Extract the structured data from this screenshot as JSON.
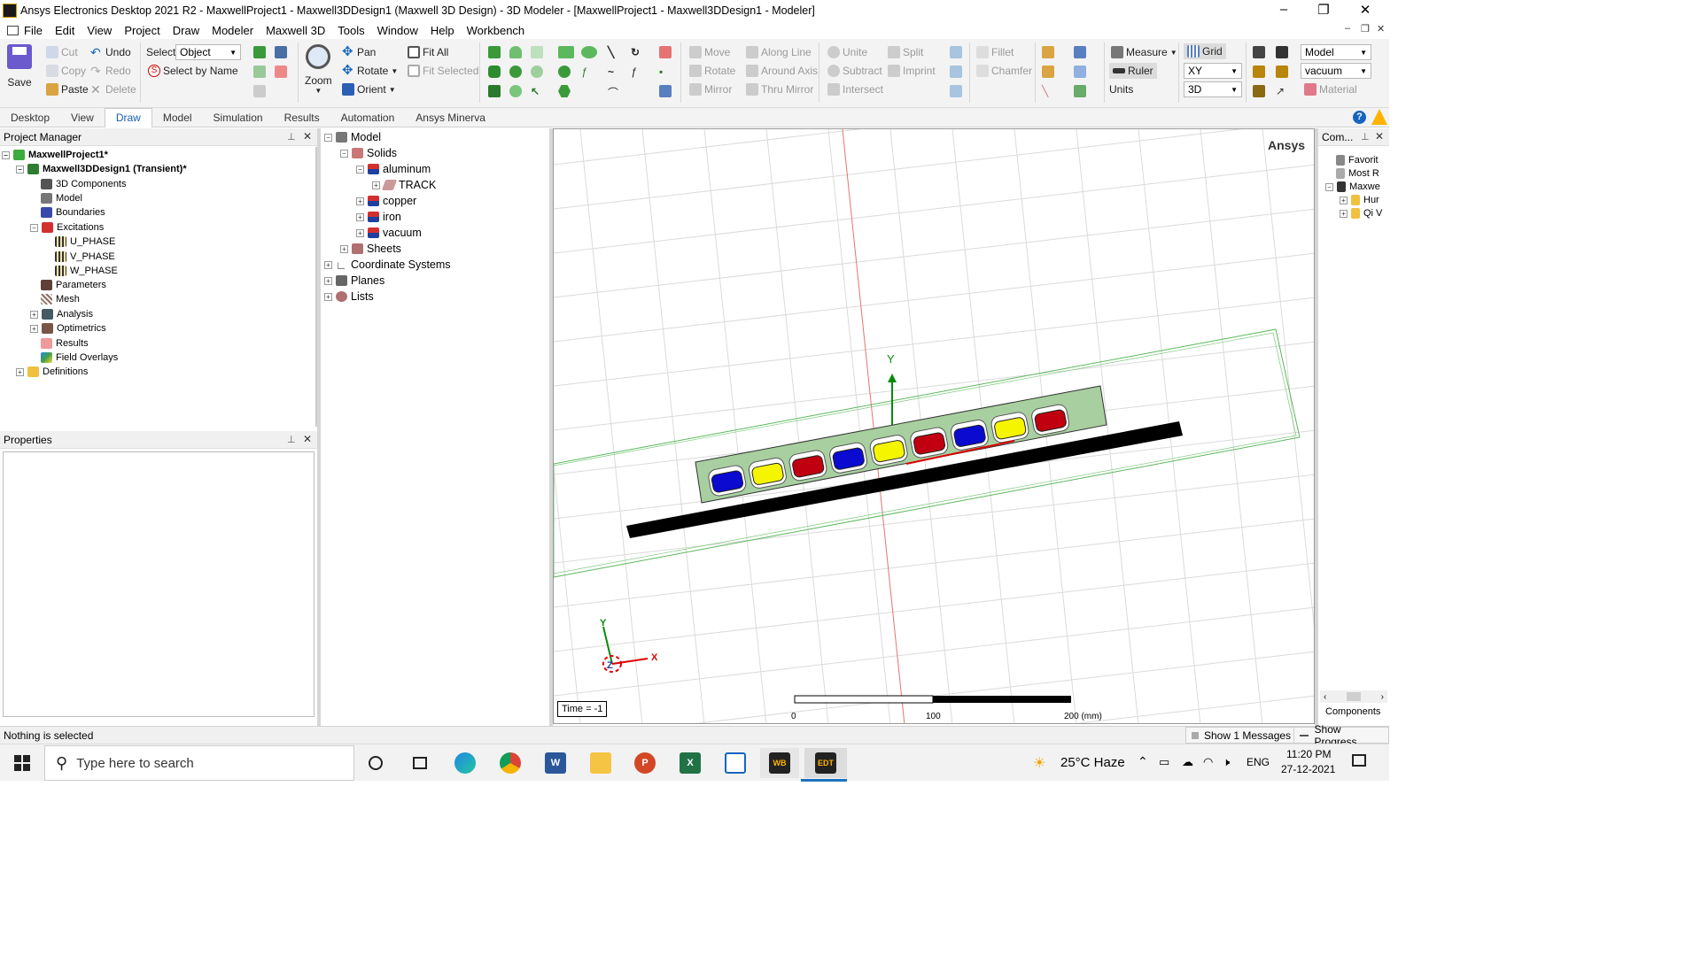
{
  "window": {
    "title": "Ansys Electronics Desktop 2021 R2 - MaxwellProject1 - Maxwell3DDesign1 (Maxwell 3D Design) - 3D Modeler - [MaxwellProject1 - Maxwell3DDesign1 - Modeler]",
    "minimize": "–",
    "maximize": "❐",
    "close": "✕"
  },
  "menu": [
    "File",
    "Edit",
    "View",
    "Project",
    "Draw",
    "Modeler",
    "Maxwell 3D",
    "Tools",
    "Window",
    "Help",
    "Workbench"
  ],
  "ribbon": {
    "save": "Save",
    "cut": "Cut",
    "copy": "Copy",
    "paste": "Paste",
    "undo": "Undo",
    "redo": "Redo",
    "delete": "Delete",
    "select_label": "Select:",
    "select_value": "Object",
    "select_by_name": "Select by Name",
    "zoom": "Zoom",
    "pan": "Pan",
    "rotate": "Rotate",
    "orient": "Orient",
    "fit_all": "Fit All",
    "fit_selected": "Fit Selected",
    "move": "Move",
    "rotate2": "Rotate",
    "mirror": "Mirror",
    "along_line": "Along Line",
    "around_axis": "Around Axis",
    "thru_mirror": "Thru Mirror",
    "unite": "Unite",
    "subtract": "Subtract",
    "intersect": "Intersect",
    "split": "Split",
    "imprint": "Imprint",
    "fillet": "Fillet",
    "chamfer": "Chamfer",
    "measure": "Measure",
    "ruler": "Ruler",
    "units": "Units",
    "grid": "Grid",
    "plane": "XY",
    "dim": "3D",
    "model": "Model",
    "material_value": "vacuum",
    "material": "Material"
  },
  "tabs": [
    "Desktop",
    "View",
    "Draw",
    "Model",
    "Simulation",
    "Results",
    "Automation",
    "Ansys Minerva"
  ],
  "active_tab": "Draw",
  "project_manager": {
    "title": "Project Manager",
    "items": [
      {
        "label": "MaxwellProject1*",
        "bold": true
      },
      {
        "label": "Maxwell3DDesign1 (Transient)*",
        "bold": true
      },
      {
        "label": "3D Components"
      },
      {
        "label": "Model"
      },
      {
        "label": "Boundaries"
      },
      {
        "label": "Excitations"
      },
      {
        "label": "U_PHASE"
      },
      {
        "label": "V_PHASE"
      },
      {
        "label": "W_PHASE"
      },
      {
        "label": "Parameters"
      },
      {
        "label": "Mesh"
      },
      {
        "label": "Analysis"
      },
      {
        "label": "Optimetrics"
      },
      {
        "label": "Results"
      },
      {
        "label": "Field Overlays"
      },
      {
        "label": "Definitions"
      }
    ]
  },
  "properties": {
    "title": "Properties"
  },
  "model_tree": [
    {
      "label": "Model"
    },
    {
      "label": "Solids"
    },
    {
      "label": "aluminum"
    },
    {
      "label": "TRACK"
    },
    {
      "label": "copper"
    },
    {
      "label": "iron"
    },
    {
      "label": "vacuum"
    },
    {
      "label": "Sheets"
    },
    {
      "label": "Coordinate Systems"
    },
    {
      "label": "Planes"
    },
    {
      "label": "Lists"
    }
  ],
  "viewport": {
    "brand": "Ansys",
    "time": "Time = -1",
    "scale_labels": [
      "0",
      "100",
      "200 (mm)"
    ],
    "axis_y": "Y",
    "axis_x": "X",
    "axis_z": "Z"
  },
  "components": {
    "title": "Com...",
    "items": [
      "Favorit",
      "Most R",
      "Maxwe",
      "Hur",
      "Qi V"
    ],
    "footer": "Components"
  },
  "status": {
    "text": "Nothing is selected",
    "messages": "Show 1 Messages",
    "progress": "Show Progress"
  },
  "taskbar": {
    "search": "Type here to search",
    "weather": "25°C  Haze",
    "lang": "ENG",
    "time": "11:20 PM",
    "date": "27-12-2021",
    "wb": "WB",
    "edt": "EDT"
  },
  "colors": {
    "yoke": "#a8cfa0",
    "coil_blue": "#0a0ad0",
    "coil_yellow": "#f5f500",
    "coil_red": "#c00010",
    "track": "#000000"
  }
}
